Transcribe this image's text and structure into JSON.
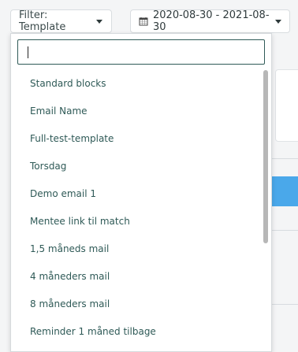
{
  "filter": {
    "label": "Filter: Template"
  },
  "date_range": {
    "label": "2020-08-30 - 2021-08-30",
    "icon": "calendar-icon"
  },
  "dropdown": {
    "search_value": "",
    "items": [
      "Standard blocks",
      "Email Name",
      "Full-test-template",
      "Torsdag",
      "Demo email 1",
      "Mentee link til match",
      "1,5 måneds mail",
      "4 måneders mail",
      "8 måneders mail",
      "Reminder 1 måned tilbage"
    ]
  },
  "colors": {
    "accent": "#2f5a57",
    "highlight": "#4aa8ea"
  }
}
